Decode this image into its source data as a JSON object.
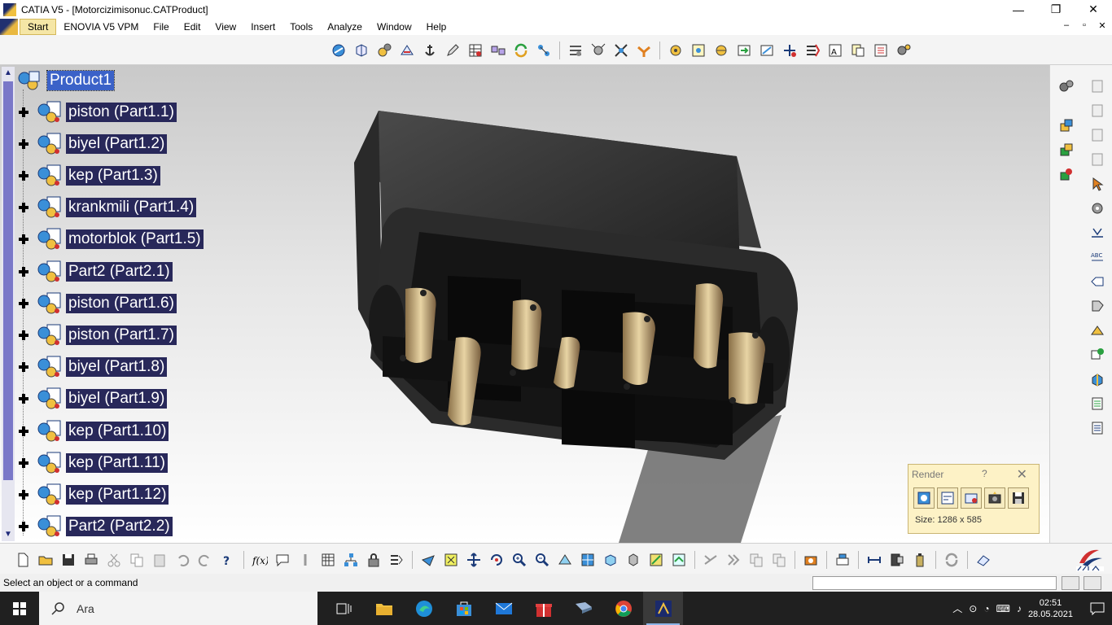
{
  "window": {
    "title": "CATIA V5 - [Motorcizimisonuc.CATProduct]",
    "minimize": "—",
    "maximize": "❐",
    "close": "✕"
  },
  "menu": {
    "items": [
      {
        "label": "Start",
        "active": true
      },
      {
        "label": "ENOVIA V5 VPM"
      },
      {
        "label": "File"
      },
      {
        "label": "Edit"
      },
      {
        "label": "View"
      },
      {
        "label": "Insert"
      },
      {
        "label": "Tools"
      },
      {
        "label": "Analyze"
      },
      {
        "label": "Window"
      },
      {
        "label": "Help"
      }
    ],
    "mdi_min": "–",
    "mdi_restore": "▫",
    "mdi_close": "✕"
  },
  "tree": {
    "root": "Product1",
    "items": [
      "piston (Part1.1)",
      "biyel (Part1.2)",
      "kep (Part1.3)",
      "krankmili (Part1.4)",
      "motorblok (Part1.5)",
      "Part2 (Part2.1)",
      "piston (Part1.6)",
      "piston (Part1.7)",
      "biyel (Part1.8)",
      "biyel (Part1.9)",
      "kep (Part1.10)",
      "kep (Part1.11)",
      "kep (Part1.12)",
      "Part2 (Part2.2)"
    ]
  },
  "render_dialog": {
    "title": "Render",
    "help": "?",
    "close": "✕",
    "size": "Size: 1286 x 585"
  },
  "status": {
    "message": "Select an object or a command"
  },
  "taskbar": {
    "search_placeholder": "Ara",
    "time": "02:51",
    "date": "28.05.2021"
  },
  "colors": {
    "tree_selected": "#3b62c8",
    "tree_label_bg": "#28285a",
    "accent": "#1f2a7a"
  }
}
